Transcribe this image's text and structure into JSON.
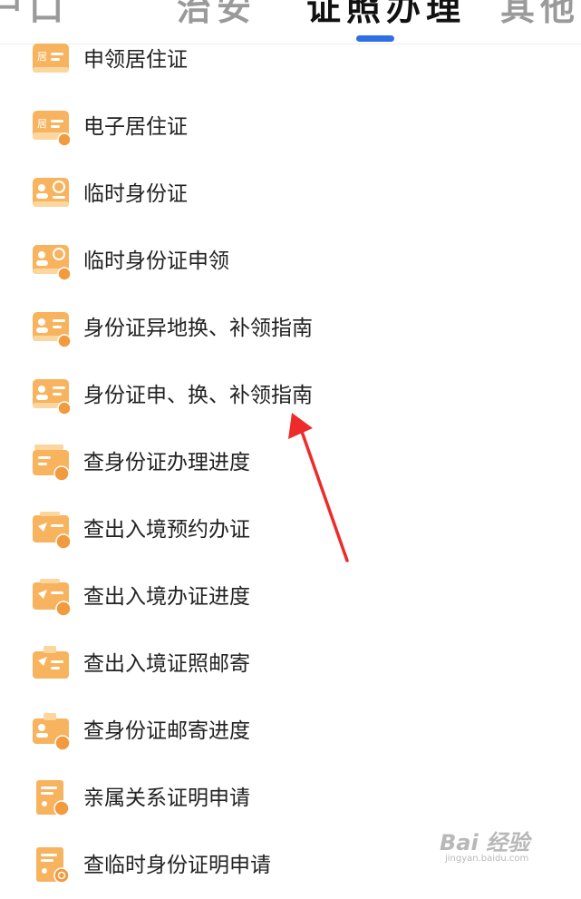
{
  "tabs": [
    {
      "label": "户口",
      "active": false
    },
    {
      "label": "治安",
      "active": false
    },
    {
      "label": "证照办理",
      "active": true
    },
    {
      "label": "其他",
      "active": false
    }
  ],
  "accent_color": "#2f6fe6",
  "icon_colors": {
    "primary": "#f7b35d",
    "secondary": "#fbd69e",
    "badge": "#f19a3e"
  },
  "list": {
    "items": [
      {
        "label": "申领居住证",
        "icon": "residence-card-icon",
        "icon_text": "居"
      },
      {
        "label": "电子居住证",
        "icon": "e-residence-card-icon",
        "icon_text": "居"
      },
      {
        "label": "临时身份证",
        "icon": "temporary-id-icon"
      },
      {
        "label": "临时身份证申领",
        "icon": "temporary-id-apply-icon"
      },
      {
        "label": "身份证异地换、补领指南",
        "icon": "id-remote-guide-icon"
      },
      {
        "label": "身份证申、换、补领指南",
        "icon": "id-guide-icon"
      },
      {
        "label": "查身份证办理进度",
        "icon": "id-progress-icon"
      },
      {
        "label": "查出入境预约办证",
        "icon": "exit-entry-appointment-icon"
      },
      {
        "label": "查出入境办证进度",
        "icon": "exit-entry-progress-icon"
      },
      {
        "label": "查出入境证照邮寄",
        "icon": "exit-entry-mail-icon"
      },
      {
        "label": "查身份证邮寄进度",
        "icon": "id-mail-progress-icon"
      },
      {
        "label": "亲属关系证明申请",
        "icon": "kinship-certificate-icon"
      },
      {
        "label": "查临时身份证明申请",
        "icon": "temporary-id-certificate-icon"
      }
    ]
  },
  "watermark": {
    "logo": "Bai 经验",
    "url": "jingyan.baidu.com"
  }
}
